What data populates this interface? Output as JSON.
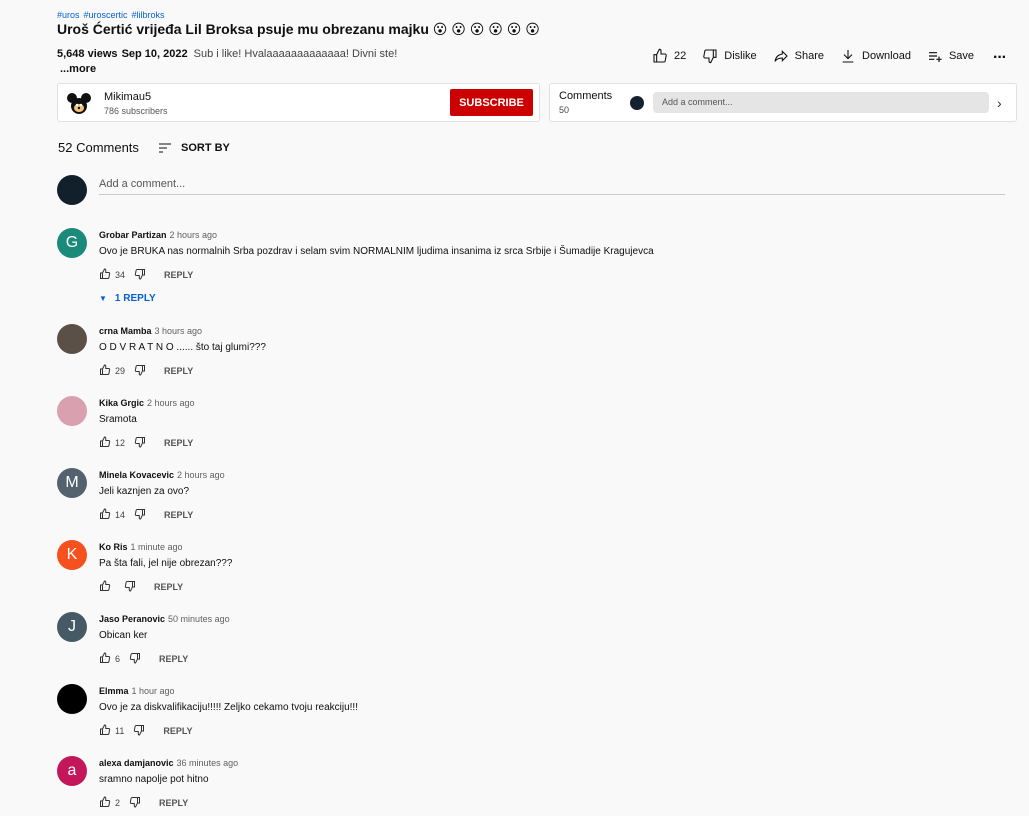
{
  "video": {
    "hashtags": [
      "#uros",
      "#uroscertic",
      "#lilbroks"
    ],
    "title": "Uroš Ćertić vrijeđa Lil Broksa psuje mu obrezanu majku 😮 😮 😮 😮 😮 😮",
    "views": "5,648 views",
    "date": "Sep 10, 2022",
    "description": "Sub i like! Hvalaaaaaaaaaaaaa! Divni ste!",
    "more_label": "...more"
  },
  "actions": {
    "likes": "22",
    "dislike_label": "Dislike",
    "share_label": "Share",
    "download_label": "Download",
    "save_label": "Save",
    "more_icon": "more-horizontal-icon"
  },
  "channel": {
    "name": "Mikimau5",
    "subscribers": "786 subscribers",
    "subscribe_label": "SUBSCRIBE"
  },
  "comments_panel": {
    "title": "Comments",
    "count": "50",
    "placeholder": "Add a comment..."
  },
  "comments_section": {
    "count_label": "52 Comments",
    "sort_label": "SORT BY",
    "add_placeholder": "Add a comment...",
    "reply_label": "REPLY"
  },
  "comments": [
    {
      "author": "Grobar Partizan",
      "time": "2 hours ago",
      "text": "Ovo je BRUKA nas normalnih Srba pozdrav i selam svim NORMALNIM ljudima insanima iz srca Srbije i Šumadije Kragujevca",
      "likes": "34",
      "initial": "G",
      "color": "#1a8a7a",
      "replies": "1 REPLY"
    },
    {
      "author": "crna Mamba",
      "time": "3 hours ago",
      "text": "O D V R A T N O ...... što taj glumi???",
      "likes": "29",
      "initial": "",
      "color": "#5a5048"
    },
    {
      "author": "Kika Grgic",
      "time": "2 hours ago",
      "text": "Sramota",
      "likes": "12",
      "initial": "",
      "color": "#d9a0b0"
    },
    {
      "author": "Minela Kovacevic",
      "time": "2 hours ago",
      "text": "Jeli kaznjen za ovo?",
      "likes": "14",
      "initial": "M",
      "color": "#546270"
    },
    {
      "author": "Ko Ris",
      "time": "1 minute ago",
      "text": "Pa šta fali, jel nije obrezan???",
      "likes": "",
      "initial": "K",
      "color": "#f4511e"
    },
    {
      "author": "Jaso Peranovic",
      "time": "50 minutes ago",
      "text": "Obican ker",
      "likes": "6",
      "initial": "J",
      "color": "#455a64"
    },
    {
      "author": "Elmma",
      "time": "1 hour ago",
      "text": "Ovo je za diskvalifikaciju!!!!! Zeljko cekamo  tvoju reakciju!!!",
      "likes": "11",
      "initial": "",
      "color": "#000000"
    },
    {
      "author": "alexa damjanovic",
      "time": "36 minutes ago",
      "text": "sramno napolje pot hitno",
      "likes": "2",
      "initial": "a",
      "color": "#c2185b"
    }
  ]
}
